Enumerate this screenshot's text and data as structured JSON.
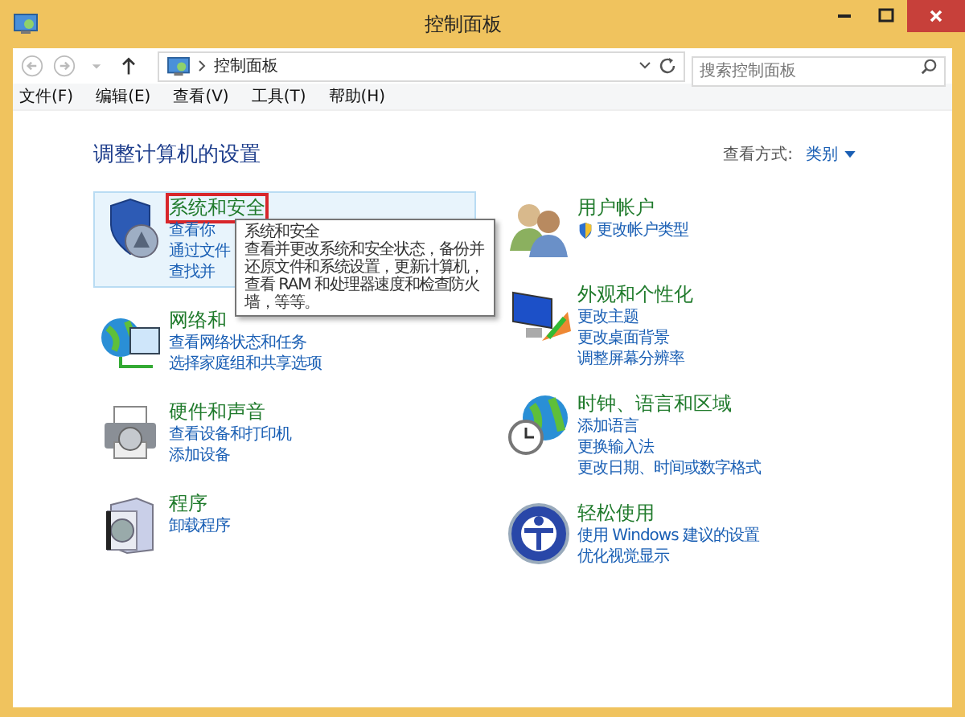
{
  "window": {
    "title": "控制面板"
  },
  "address": {
    "crumb": "控制面板"
  },
  "search": {
    "placeholder": "搜索控制面板"
  },
  "menu": [
    "文件(F)",
    "编辑(E)",
    "查看(V)",
    "工具(T)",
    "帮助(H)"
  ],
  "heading": "调整计算机的设置",
  "view_by": {
    "label": "查看方式:",
    "value": "类别"
  },
  "left_categories": [
    {
      "title": "系统和安全",
      "hovered": true,
      "links": [
        {
          "text": "查看你",
          "shield": false
        },
        {
          "text": "通过文件",
          "shield": false
        },
        {
          "text": "查找并",
          "shield": false
        }
      ]
    },
    {
      "title": "网络和",
      "hovered": false,
      "links": [
        {
          "text": "查看网络状态和任务",
          "shield": false
        },
        {
          "text": "选择家庭组和共享选项",
          "shield": false
        }
      ]
    },
    {
      "title": "硬件和声音",
      "hovered": false,
      "links": [
        {
          "text": "查看设备和打印机",
          "shield": false
        },
        {
          "text": "添加设备",
          "shield": false
        }
      ]
    },
    {
      "title": "程序",
      "hovered": false,
      "links": [
        {
          "text": "卸载程序",
          "shield": false
        }
      ]
    }
  ],
  "right_categories": [
    {
      "title": "用户帐户",
      "hovered": false,
      "links": [
        {
          "text": "更改帐户类型",
          "shield": true
        }
      ]
    },
    {
      "title": "外观和个性化",
      "hovered": false,
      "links": [
        {
          "text": "更改主题",
          "shield": false
        },
        {
          "text": "更改桌面背景",
          "shield": false
        },
        {
          "text": "调整屏幕分辨率",
          "shield": false
        }
      ]
    },
    {
      "title": "时钟、语言和区域",
      "hovered": false,
      "links": [
        {
          "text": "添加语言",
          "shield": false
        },
        {
          "text": "更换输入法",
          "shield": false
        },
        {
          "text": "更改日期、时间或数字格式",
          "shield": false
        }
      ]
    },
    {
      "title": "轻松使用",
      "hovered": false,
      "links": [
        {
          "text": "使用 Windows 建议的设置",
          "shield": false
        },
        {
          "text": "优化视觉显示",
          "shield": false
        }
      ]
    }
  ],
  "tooltip": {
    "title": "系统和安全",
    "text": "查看并更改系统和安全状态，备份并还原文件和系统设置，更新计算机，查看 RAM 和处理器速度和检查防火墙，等等。"
  }
}
